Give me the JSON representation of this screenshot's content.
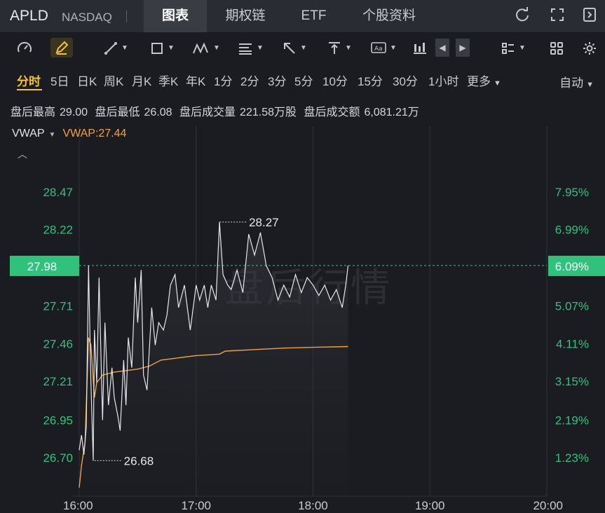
{
  "header": {
    "ticker": "APLD",
    "exchange": "NASDAQ",
    "tabs": [
      {
        "label": "图表",
        "active": true
      },
      {
        "label": "期权链",
        "active": false
      },
      {
        "label": "ETF",
        "active": false
      },
      {
        "label": "个股资料",
        "active": false
      }
    ],
    "icons": [
      "refresh-icon",
      "fullscreen-icon",
      "collapse-panel-icon"
    ]
  },
  "toolbar": {
    "icons": [
      "gauge-icon",
      "pencil-icon",
      "line-tool-icon",
      "rectangle-tool-icon",
      "pattern-tool-icon",
      "fib-tool-icon",
      "arrow-tool-icon",
      "measure-tool-icon",
      "text-tool-icon",
      "candle-type-icon",
      "prev-icon",
      "next-icon",
      "layout-icon",
      "grid-icon",
      "settings-icon"
    ]
  },
  "periods": {
    "items": [
      "分时",
      "5日",
      "日K",
      "周K",
      "月K",
      "季K",
      "年K",
      "1分",
      "2分",
      "3分",
      "5分",
      "10分",
      "15分",
      "30分",
      "1小时",
      "更多"
    ],
    "active": "分时",
    "mode": "自动"
  },
  "after_hours": {
    "high_label": "盘后最高",
    "high": "29.00",
    "low_label": "盘后最低",
    "low": "26.08",
    "volume_label": "盘后成交量",
    "volume": "221.58万股",
    "turnover_label": "盘后成交额",
    "turnover": "6,081.21万"
  },
  "indicator": {
    "name": "VWAP",
    "value_text": "VWAP:27.44"
  },
  "watermark": "盘后行情",
  "colors": {
    "price_line": "#e6e7ea",
    "vwap_line": "#f2a23a",
    "up_green": "#2fc27d",
    "current_badge": "#2fc27d",
    "grid": "#2f3138"
  },
  "chart_data": {
    "type": "line",
    "x_tick_labels": [
      "16:00",
      "17:00",
      "18:00",
      "19:00",
      "20:00"
    ],
    "x_range_hours": [
      16,
      20
    ],
    "y_left_ticks": [
      28.47,
      28.22,
      27.98,
      27.71,
      27.46,
      27.21,
      26.95,
      26.7
    ],
    "y_right_ticks": [
      "7.95%",
      "6.99%",
      "6.09%",
      "5.07%",
      "4.11%",
      "3.15%",
      "2.19%",
      "1.23%"
    ],
    "ylim": [
      26.43,
      28.73
    ],
    "current_price": 27.98,
    "current_pct": "6.09%",
    "annotations": [
      {
        "label": "28.27",
        "x": 17.2,
        "y": 28.27
      },
      {
        "label": "26.68",
        "x": 16.13,
        "y": 26.68
      }
    ],
    "series": [
      {
        "name": "price",
        "x": [
          16.0,
          16.02,
          16.04,
          16.06,
          16.08,
          16.1,
          16.12,
          16.13,
          16.15,
          16.17,
          16.2,
          16.22,
          16.25,
          16.28,
          16.3,
          16.33,
          16.35,
          16.38,
          16.4,
          16.42,
          16.45,
          16.48,
          16.5,
          16.53,
          16.55,
          16.58,
          16.62,
          16.65,
          16.68,
          16.72,
          16.75,
          16.78,
          16.82,
          16.85,
          16.9,
          16.95,
          17.0,
          17.03,
          17.07,
          17.1,
          17.13,
          17.17,
          17.2,
          17.23,
          17.27,
          17.3,
          17.35,
          17.4,
          17.45,
          17.5,
          17.55,
          17.6,
          17.65,
          17.7,
          17.75,
          17.8,
          17.85,
          17.9,
          17.95,
          18.0,
          18.05,
          18.1,
          18.15,
          18.2,
          18.25,
          18.28,
          18.3
        ],
        "y": [
          26.75,
          26.85,
          26.72,
          26.9,
          27.98,
          27.2,
          26.68,
          27.55,
          27.2,
          27.9,
          26.95,
          27.6,
          27.05,
          27.3,
          27.1,
          26.98,
          26.88,
          27.35,
          27.05,
          27.5,
          27.3,
          27.9,
          27.6,
          27.95,
          27.25,
          27.15,
          27.7,
          27.45,
          27.6,
          27.55,
          27.65,
          27.85,
          27.92,
          27.7,
          27.85,
          27.55,
          27.85,
          27.75,
          27.85,
          27.7,
          27.85,
          27.75,
          28.27,
          27.92,
          27.85,
          27.82,
          27.95,
          27.8,
          28.19,
          28.05,
          28.2,
          27.98,
          27.9,
          27.75,
          27.85,
          27.77,
          27.92,
          27.8,
          27.9,
          27.85,
          27.78,
          27.85,
          27.75,
          27.82,
          27.7,
          27.85,
          27.98
        ]
      },
      {
        "name": "VWAP",
        "x": [
          16.0,
          16.02,
          16.05,
          16.08,
          16.1,
          16.13,
          16.15,
          16.2,
          16.3,
          16.4,
          16.5,
          16.6,
          16.7,
          16.8,
          16.9,
          17.0,
          17.2,
          17.25,
          17.5,
          17.75,
          18.0,
          18.3
        ],
        "y": [
          26.5,
          26.65,
          26.8,
          27.5,
          27.45,
          27.1,
          27.2,
          27.25,
          27.27,
          27.28,
          27.29,
          27.31,
          27.35,
          27.36,
          27.37,
          27.38,
          27.39,
          27.41,
          27.42,
          27.43,
          27.435,
          27.44
        ]
      }
    ]
  }
}
